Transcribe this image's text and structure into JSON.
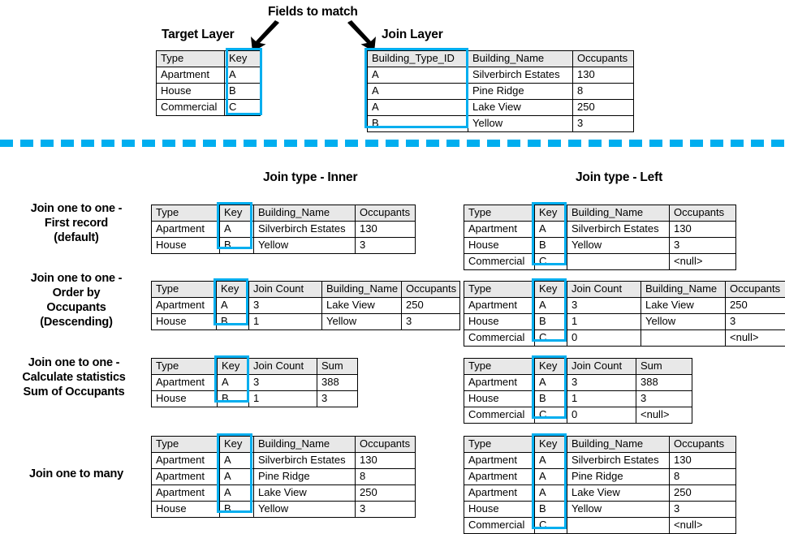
{
  "top": {
    "fields_to_match_label": "Fields to match",
    "target_layer_label": "Target Layer",
    "join_layer_label": "Join Layer",
    "target_table": {
      "headers": [
        "Type",
        "Key"
      ],
      "rows": [
        [
          "Apartment",
          "A"
        ],
        [
          "House",
          "B"
        ],
        [
          "Commercial",
          "C"
        ]
      ]
    },
    "join_table": {
      "headers": [
        "Building_Type_ID",
        "Building_Name",
        "Occupants"
      ],
      "rows": [
        [
          "A",
          "Silverbirch Estates",
          "130"
        ],
        [
          "A",
          "Pine Ridge",
          "8"
        ],
        [
          "A",
          "Lake View",
          "250"
        ],
        [
          "B",
          "Yellow",
          "3"
        ]
      ]
    }
  },
  "columns": {
    "inner_title": "Join type - Inner",
    "left_title": "Join type - Left"
  },
  "rows": [
    {
      "label_lines": [
        "Join one to one -",
        "First record",
        "(default)"
      ],
      "inner": {
        "headers": [
          "Type",
          "Key",
          "Building_Name",
          "Occupants"
        ],
        "rows": [
          [
            "Apartment",
            "A",
            "Silverbirch Estates",
            "130"
          ],
          [
            "House",
            "B",
            "Yellow",
            "3"
          ]
        ]
      },
      "left": {
        "headers": [
          "Type",
          "Key",
          "Building_Name",
          "Occupants"
        ],
        "rows": [
          [
            "Apartment",
            "A",
            "Silverbirch Estates",
            "130"
          ],
          [
            "House",
            "B",
            "Yellow",
            "3"
          ],
          [
            "Commercial",
            "C",
            "",
            "<null>"
          ]
        ]
      }
    },
    {
      "label_lines": [
        "Join one to one -",
        "Order by",
        "Occupants",
        "(Descending)"
      ],
      "inner": {
        "headers": [
          "Type",
          "Key",
          "Join Count",
          "Building_Name",
          "Occupants"
        ],
        "rows": [
          [
            "Apartment",
            "A",
            "3",
            "Lake View",
            "250"
          ],
          [
            "House",
            "B",
            "1",
            "Yellow",
            "3"
          ]
        ]
      },
      "left": {
        "headers": [
          "Type",
          "Key",
          "Join Count",
          "Building_Name",
          "Occupants"
        ],
        "rows": [
          [
            "Apartment",
            "A",
            "3",
            "Lake View",
            "250"
          ],
          [
            "House",
            "B",
            "1",
            "Yellow",
            "3"
          ],
          [
            "Commercial",
            "C",
            "0",
            "",
            "<null>"
          ]
        ]
      }
    },
    {
      "label_lines": [
        "Join one to one -",
        "Calculate statistics",
        "Sum of Occupants"
      ],
      "inner": {
        "headers": [
          "Type",
          "Key",
          "Join Count",
          "Sum"
        ],
        "rows": [
          [
            "Apartment",
            "A",
            "3",
            "388"
          ],
          [
            "House",
            "B",
            "1",
            "3"
          ]
        ]
      },
      "left": {
        "headers": [
          "Type",
          "Key",
          "Join Count",
          "Sum"
        ],
        "rows": [
          [
            "Apartment",
            "A",
            "3",
            "388"
          ],
          [
            "House",
            "B",
            "1",
            "3"
          ],
          [
            "Commercial",
            "C",
            "0",
            "<null>"
          ]
        ]
      }
    },
    {
      "label_lines": [
        "Join one to many"
      ],
      "inner": {
        "headers": [
          "Type",
          "Key",
          "Building_Name",
          "Occupants"
        ],
        "rows": [
          [
            "Apartment",
            "A",
            "Silverbirch Estates",
            "130"
          ],
          [
            "Apartment",
            "A",
            "Pine Ridge",
            "8"
          ],
          [
            "Apartment",
            "A",
            "Lake View",
            "250"
          ],
          [
            "House",
            "B",
            "Yellow",
            "3"
          ]
        ]
      },
      "left": {
        "headers": [
          "Type",
          "Key",
          "Building_Name",
          "Occupants"
        ],
        "rows": [
          [
            "Apartment",
            "A",
            "Silverbirch Estates",
            "130"
          ],
          [
            "Apartment",
            "A",
            "Pine Ridge",
            "8"
          ],
          [
            "Apartment",
            "A",
            "Lake View",
            "250"
          ],
          [
            "House",
            "B",
            "Yellow",
            "3"
          ],
          [
            "Commercial",
            "C",
            "",
            "<null>"
          ]
        ]
      }
    }
  ],
  "colors": {
    "highlight": "#00AEEF",
    "divider": "#00AEEF",
    "header_fill": "#E8E8E8",
    "border": "#000000",
    "text": "#000000"
  },
  "icons": {
    "arrow_left": "down-left-arrow-icon",
    "arrow_right": "down-right-arrow-icon",
    "divider": "dashed-divider-icon"
  }
}
